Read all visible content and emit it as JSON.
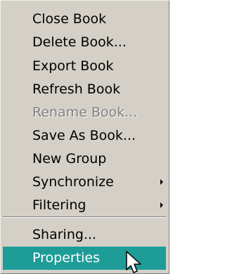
{
  "menu": {
    "items": [
      {
        "label": "Close Book"
      },
      {
        "label": "Delete Book..."
      },
      {
        "label": "Export Book"
      },
      {
        "label": "Refresh Book"
      },
      {
        "label": "Rename Book...",
        "state": "disabled"
      },
      {
        "label": "Save As Book..."
      },
      {
        "label": "New Group"
      },
      {
        "label": "Synchronize",
        "submenu": true
      },
      {
        "label": "Filtering",
        "submenu": true
      },
      {
        "label": "Sharing..."
      },
      {
        "label": "Properties",
        "state": "highlighted"
      }
    ]
  },
  "colors": {
    "menu_background": "#d4d0c8",
    "highlight_background": "#1e9d98",
    "disabled_text": "#808080"
  },
  "icons": {
    "submenu": "submenu-arrow-icon",
    "cursor": "mouse-pointer-icon"
  }
}
